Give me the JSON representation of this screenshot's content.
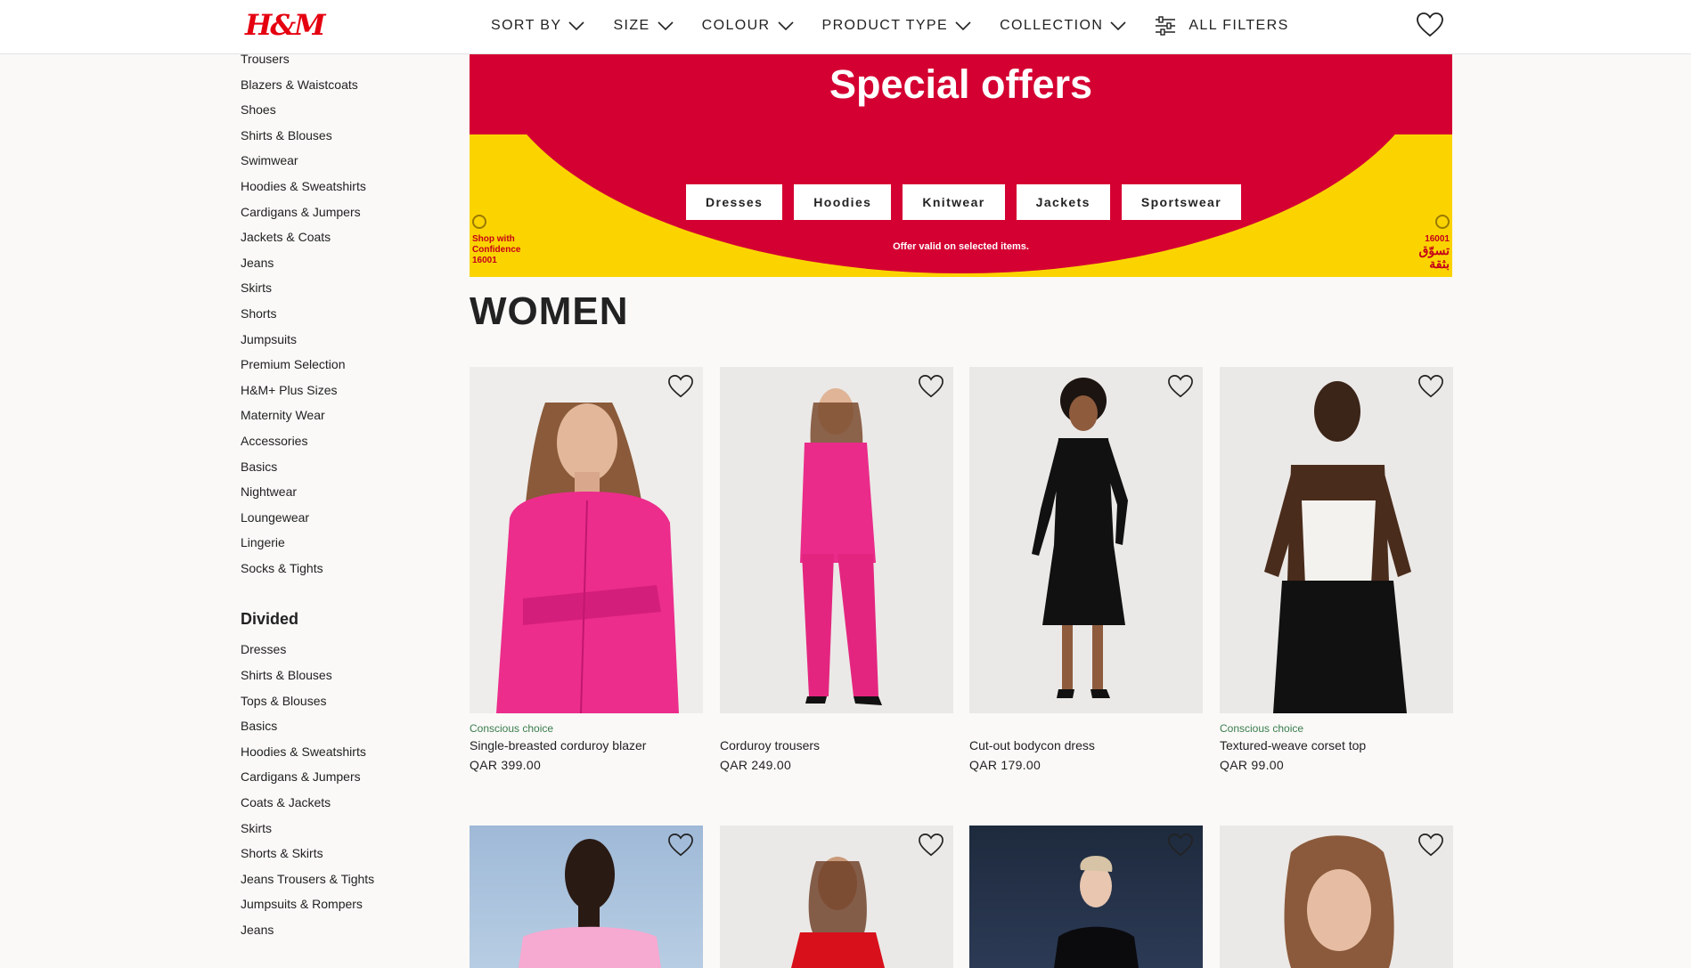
{
  "header": {
    "logo": "H&M",
    "filters": [
      {
        "label": "SORT BY"
      },
      {
        "label": "SIZE"
      },
      {
        "label": "COLOUR"
      },
      {
        "label": "PRODUCT TYPE"
      },
      {
        "label": "COLLECTION"
      }
    ],
    "all_filters_label": "ALL FILTERS"
  },
  "sidebar": {
    "women_items": [
      "Trousers",
      "Blazers & Waistcoats",
      "Shoes",
      "Shirts & Blouses",
      "Swimwear",
      "Hoodies & Sweatshirts",
      "Cardigans & Jumpers",
      "Jackets & Coats",
      "Jeans",
      "Skirts",
      "Shorts",
      "Jumpsuits",
      "Premium Selection",
      "H&M+ Plus Sizes",
      "Maternity Wear",
      "Accessories",
      "Basics",
      "Nightwear",
      "Loungewear",
      "Lingerie",
      "Socks & Tights"
    ],
    "divided_heading": "Divided",
    "divided_items": [
      "Dresses",
      "Shirts & Blouses",
      "Tops & Blouses",
      "Basics",
      "Hoodies & Sweatshirts",
      "Cardigans & Jumpers",
      "Coats & Jackets",
      "Skirts",
      "Shorts & Skirts",
      "Jeans Trousers & Tights",
      "Jumpsuits & Rompers",
      "Jeans"
    ]
  },
  "banner": {
    "title": "Special offers",
    "buttons": [
      "Dresses",
      "Hoodies",
      "Knitwear",
      "Jackets",
      "Sportswear"
    ],
    "note": "Offer valid on selected items.",
    "seal_left": [
      "Shop with",
      "Confidence",
      "16001"
    ],
    "seal_right": [
      "تسوّق",
      "بثقة",
      "16001"
    ],
    "colors": {
      "red": "#d40032",
      "yellow": "#fbd400"
    }
  },
  "section_title": "WOMEN",
  "products": [
    {
      "tag": "Conscious choice",
      "name": "Single-breasted corduroy blazer",
      "price": "QAR  399.00"
    },
    {
      "tag": "",
      "name": "Corduroy trousers",
      "price": "QAR  249.00"
    },
    {
      "tag": "",
      "name": "Cut-out bodycon dress",
      "price": "QAR  179.00"
    },
    {
      "tag": "Conscious choice",
      "name": "Textured-weave corset top",
      "price": "QAR  99.00"
    }
  ],
  "icons": {
    "favourite": "heart-icon",
    "dropdown": "chevron-down-icon",
    "filters": "sliders-icon"
  },
  "accent_color": "#e50010"
}
